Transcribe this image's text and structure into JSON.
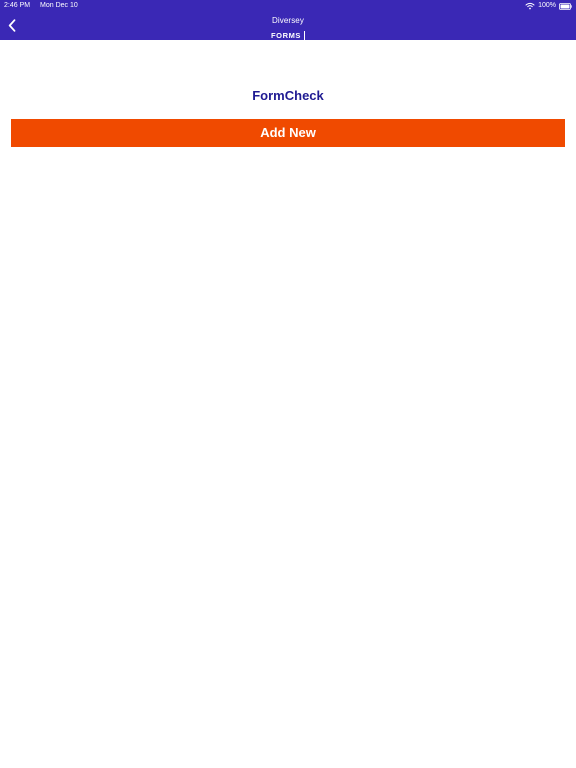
{
  "status_bar": {
    "time": "2:46 PM",
    "date": "Mon Dec 10",
    "battery": "100%",
    "icons": {
      "wifi": "wifi-icon",
      "battery": "battery-icon"
    }
  },
  "nav_bar": {
    "back_icon": "chevron-left-icon",
    "brand": {
      "line1": "Diversey",
      "line2": "FORMS"
    }
  },
  "main": {
    "title": "FormCheck",
    "add_button_label": "Add New"
  },
  "colors": {
    "header_bg": "#3a28b5",
    "title_text": "#1f1a92",
    "add_button_bg": "#f04a00",
    "white": "#ffffff"
  }
}
